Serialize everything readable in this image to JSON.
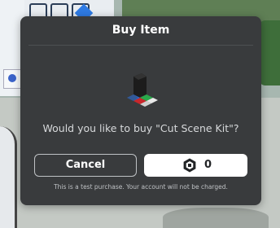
{
  "dialog": {
    "title": "Buy Item",
    "item_name": "Cut Scene Kit",
    "question": "Would you like to buy \"Cut Scene Kit\"?",
    "cancel_label": "Cancel",
    "buy_price": "0",
    "currency_icon": "robux-icon",
    "note": "This is a test purchase. Your account will not be charged."
  },
  "colors": {
    "dialog_bg": "#393b3d",
    "buy_button_bg": "#ffffff",
    "text_primary": "#ffffff"
  }
}
